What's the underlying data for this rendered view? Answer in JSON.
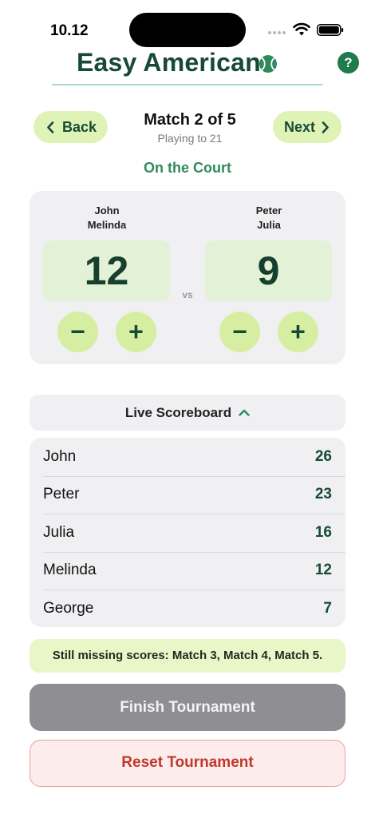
{
  "status_bar": {
    "time": "10.12"
  },
  "header": {
    "title": "Easy American",
    "help_label": "?"
  },
  "nav": {
    "back_label": "Back",
    "next_label": "Next",
    "match_title": "Match 2 of 5",
    "match_subtitle": "Playing to 21"
  },
  "court": {
    "label": "On the Court",
    "vs_label": "vs",
    "team_a": {
      "player1": "John",
      "player2": "Melinda",
      "score": "12",
      "minus": "−",
      "plus": "+"
    },
    "team_b": {
      "player1": "Peter",
      "player2": "Julia",
      "score": "9",
      "minus": "−",
      "plus": "+"
    }
  },
  "scoreboard": {
    "toggle_label": "Live Scoreboard",
    "rows": [
      {
        "name": "John",
        "score": "26"
      },
      {
        "name": "Peter",
        "score": "23"
      },
      {
        "name": "Julia",
        "score": "16"
      },
      {
        "name": "Melinda",
        "score": "12"
      },
      {
        "name": "George",
        "score": "7"
      }
    ]
  },
  "missing_scores": "Still missing scores: Match 3, Match 4, Match 5.",
  "actions": {
    "finish_label": "Finish Tournament",
    "reset_label": "Reset Tournament"
  },
  "colors": {
    "brand_dark_green": "#174a35",
    "accent_green": "#2f8a5c",
    "lime_button": "#dff3b6",
    "score_box": "#e3f1d6",
    "finish_disabled": "#8e8e93",
    "reset_red": "#c0392b"
  },
  "icons": [
    "wifi-icon",
    "battery-icon",
    "tennis-ball-icon",
    "help-icon",
    "chevron-left-icon",
    "chevron-right-icon",
    "chevron-up-icon"
  ]
}
